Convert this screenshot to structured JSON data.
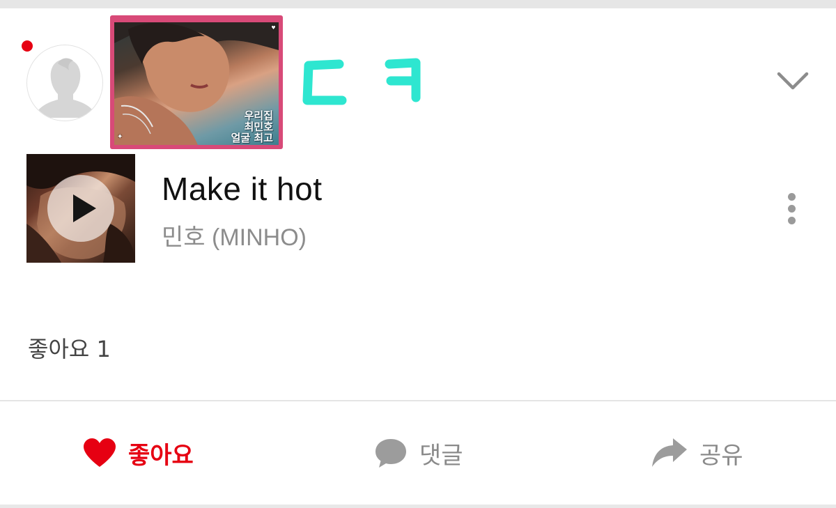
{
  "post": {
    "sticker_caption": [
      "우리집",
      "최민호",
      "얼굴 최고"
    ],
    "doodle_text": "ㄷ ㅋ"
  },
  "track": {
    "title": "Make it hot",
    "artist": "민호 (MINHO)"
  },
  "likes": {
    "summary": "좋아요 1"
  },
  "actions": {
    "like_label": "좋아요",
    "comment_label": "댓글",
    "share_label": "공유"
  },
  "colors": {
    "accent": "#e60012",
    "doodle": "#2ee6d0",
    "muted": "#8a8a8a"
  },
  "icons": {
    "avatar": "default-user-icon",
    "collapse": "chevron-down-icon",
    "play": "play-icon",
    "more": "more-vertical-icon",
    "like": "heart-icon",
    "comment": "speech-bubble-icon",
    "share": "share-arrow-icon"
  }
}
